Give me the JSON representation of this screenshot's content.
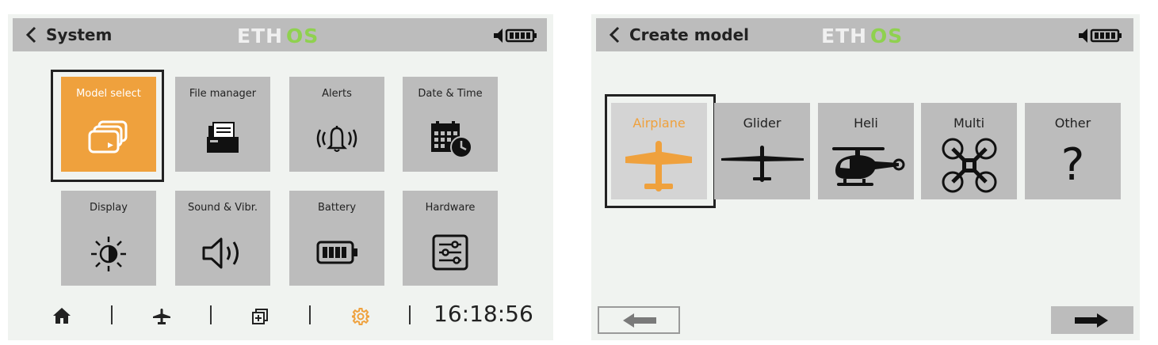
{
  "left_screen": {
    "header": {
      "title": "System",
      "logo_text_a": "ETH",
      "logo_text_b": "OS"
    },
    "tiles": [
      {
        "label": "Model select",
        "icon": "model-select-icon",
        "selected": true
      },
      {
        "label": "File manager",
        "icon": "file-manager-icon"
      },
      {
        "label": "Alerts",
        "icon": "bell-icon"
      },
      {
        "label": "Date & Time",
        "icon": "calendar-clock-icon"
      },
      {
        "label": "Display",
        "icon": "brightness-icon"
      },
      {
        "label": "Sound & Vibr.",
        "icon": "speaker-icon"
      },
      {
        "label": "Battery",
        "icon": "battery-icon"
      },
      {
        "label": "Hardware",
        "icon": "sliders-icon"
      }
    ],
    "footer": {
      "items": [
        "home-icon",
        "airplane-icon",
        "model-setup-icon",
        "gear-icon"
      ],
      "active": "gear-icon",
      "clock": "16:18:56"
    }
  },
  "right_screen": {
    "header": {
      "title": "Create model",
      "logo_text_a": "ETH",
      "logo_text_b": "OS"
    },
    "categories": [
      {
        "label": "Airplane",
        "icon": "airplane-icon",
        "selected": true
      },
      {
        "label": "Glider",
        "icon": "glider-icon"
      },
      {
        "label": "Heli",
        "icon": "helicopter-icon"
      },
      {
        "label": "Multi",
        "icon": "quadcopter-icon"
      },
      {
        "label": "Other",
        "icon": "question-mark-icon",
        "glyph": "?"
      }
    ],
    "nav": {
      "back": "arrow-left-icon",
      "next": "arrow-right-icon"
    }
  },
  "colors": {
    "accent": "#efa13d",
    "logo_green": "#8fd14f",
    "tile": "#bcbcbc",
    "background": "#f0f3f0"
  }
}
